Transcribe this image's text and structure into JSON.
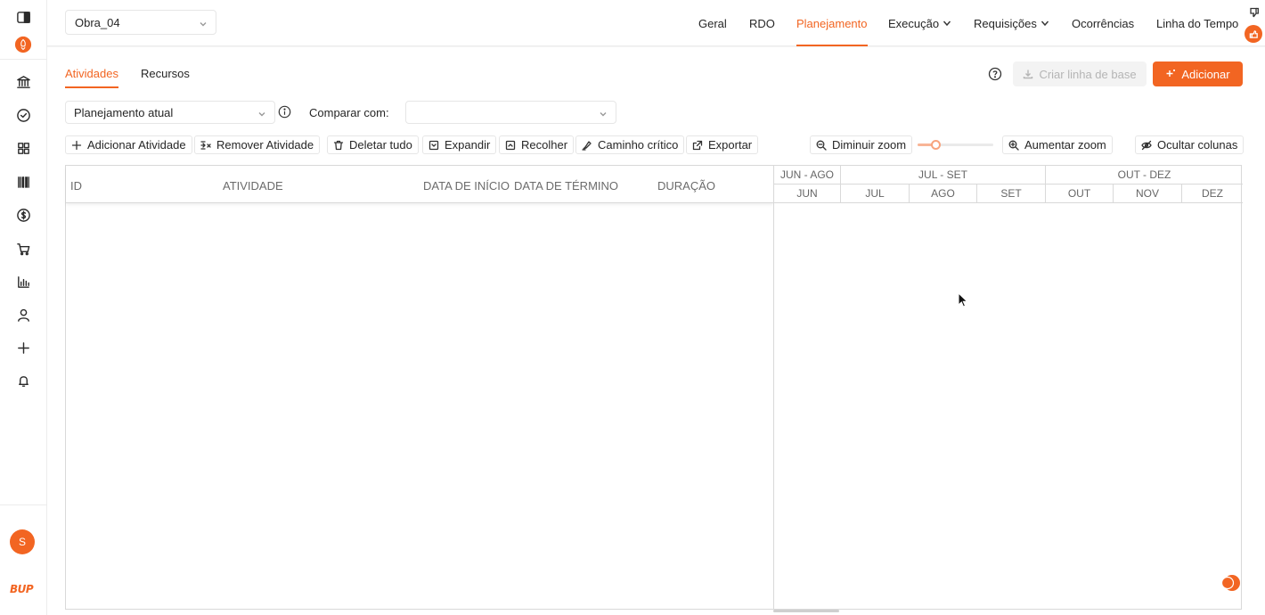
{
  "topbar": {
    "project": "Obra_04",
    "nav": [
      {
        "label": "Geral",
        "active": false,
        "dropdown": false
      },
      {
        "label": "RDO",
        "active": false,
        "dropdown": false
      },
      {
        "label": "Planejamento",
        "active": true,
        "dropdown": false
      },
      {
        "label": "Execução",
        "active": false,
        "dropdown": true
      },
      {
        "label": "Requisições",
        "active": false,
        "dropdown": true
      },
      {
        "label": "Ocorrências",
        "active": false,
        "dropdown": false
      },
      {
        "label": "Linha do Tempo",
        "active": false,
        "dropdown": false
      }
    ]
  },
  "sidebar": {
    "icons": [
      "panel-toggle-icon",
      "rocket-icon",
      "bank-icon",
      "check-circle-icon",
      "grid-icon",
      "barcode-icon",
      "dollar-icon",
      "cart-icon",
      "bar-chart-icon",
      "user-icon",
      "plus-icon",
      "bell-icon"
    ],
    "avatar_initial": "S",
    "logo_text": "BUP"
  },
  "subtabs": [
    {
      "label": "Atividades",
      "active": true
    },
    {
      "label": "Recursos",
      "active": false
    }
  ],
  "actions": {
    "baseline_label": "Criar linha de base",
    "add_label": "Adicionar"
  },
  "filters": {
    "plan_value": "Planejamento atual",
    "compare_label": "Comparar com:",
    "compare_value": ""
  },
  "toolbar": {
    "add_activity": "Adicionar Atividade",
    "remove_activity": "Remover Atividade",
    "delete_all": "Deletar tudo",
    "expand": "Expandir",
    "collapse": "Recolher",
    "critical_path": "Caminho crítico",
    "export": "Exportar",
    "zoom_out": "Diminuir zoom",
    "zoom_in": "Aumentar zoom",
    "zoom_level": 0.2,
    "hide_columns": "Ocultar colunas"
  },
  "grid": {
    "columns": [
      "ID",
      "ATIVIDADE",
      "DATA DE INÍCIO",
      "DATA DE TÉRMINO",
      "DURAÇÃO"
    ],
    "rows": []
  },
  "timeline": {
    "quarters": [
      "JUN - AGO",
      "JUL - SET",
      "OUT - DEZ"
    ],
    "months": [
      "JUN",
      "JUL",
      "AGO",
      "SET",
      "OUT",
      "NOV",
      "DEZ"
    ]
  },
  "colors": {
    "accent": "#f26522",
    "border": "#d9d9d9"
  }
}
